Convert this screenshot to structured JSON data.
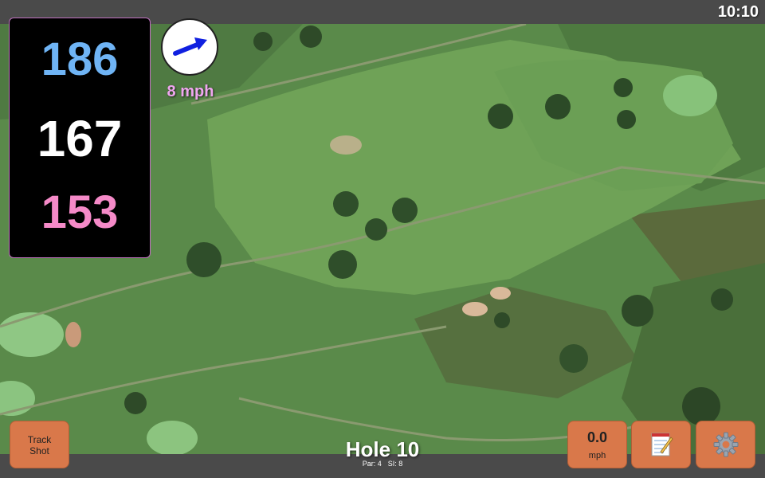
{
  "status_bar": {
    "time": "10:10"
  },
  "distances": {
    "back": "186",
    "middle": "167",
    "front": "153",
    "colors": {
      "back": "#6fb4f5",
      "middle": "#ffffff",
      "front": "#f58ac8"
    }
  },
  "wind": {
    "speed": "8 mph",
    "direction_icon": "arrow-right-up-icon",
    "color": "#f0a6f0",
    "arrow_color": "#1020e0"
  },
  "hole": {
    "title": "Hole 10",
    "par": "Par: 4",
    "stroke_index": "SI: 8"
  },
  "buttons": {
    "track_shot": "Track\nShot",
    "speed_value": "0.0",
    "speed_unit": "mph",
    "notes_icon": "notepad-icon",
    "settings_icon": "gear-icon",
    "color": "#d9784a"
  }
}
